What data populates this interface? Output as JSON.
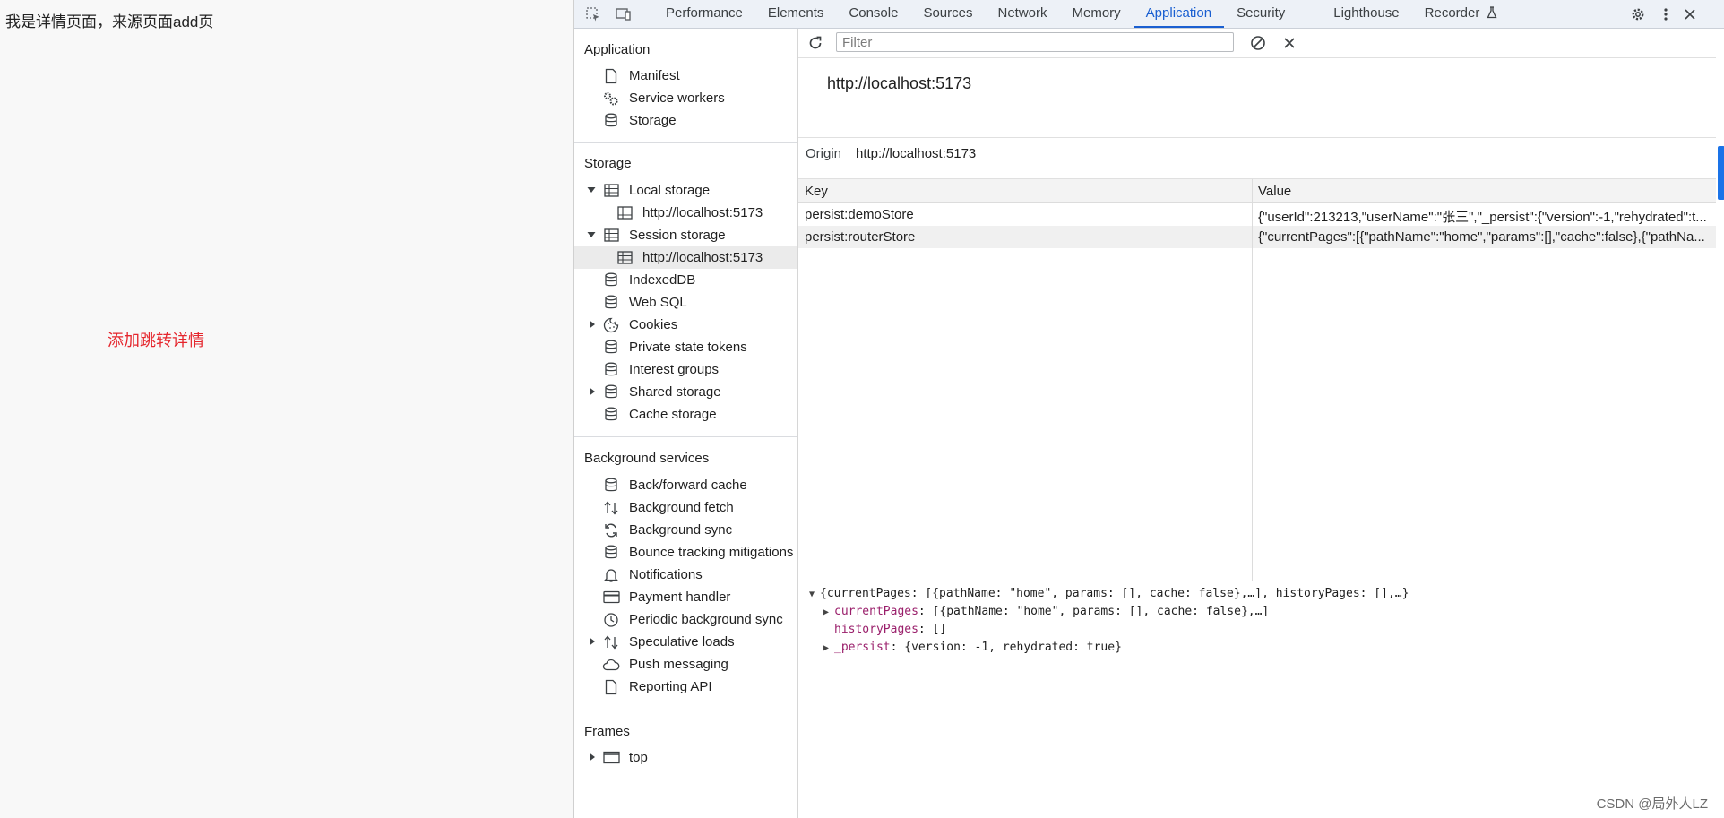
{
  "page": {
    "heading": "我是详情页面，来源页面add页",
    "link": "添加跳转详情"
  },
  "toolbar": {
    "tabs": [
      {
        "label": "Performance"
      },
      {
        "label": "Elements"
      },
      {
        "label": "Console"
      },
      {
        "label": "Sources"
      },
      {
        "label": "Network"
      },
      {
        "label": "Memory"
      },
      {
        "label": "Application"
      },
      {
        "label": "Security"
      },
      {
        "label": "Lighthouse"
      },
      {
        "label": "Recorder"
      }
    ],
    "active_tab": "Application"
  },
  "sidebar": {
    "application": {
      "title": "Application",
      "items": [
        {
          "label": "Manifest",
          "icon": "file-icon"
        },
        {
          "label": "Service workers",
          "icon": "gears-icon"
        },
        {
          "label": "Storage",
          "icon": "database-icon"
        }
      ]
    },
    "storage": {
      "title": "Storage",
      "items": [
        {
          "label": "Local storage",
          "icon": "table-icon",
          "expanded": true
        },
        {
          "label": "http://localhost:5173",
          "icon": "table-icon"
        },
        {
          "label": "Session storage",
          "icon": "table-icon",
          "expanded": true
        },
        {
          "label": "http://localhost:5173",
          "icon": "table-icon",
          "selected": true
        },
        {
          "label": "IndexedDB",
          "icon": "database-icon"
        },
        {
          "label": "Web SQL",
          "icon": "database-icon"
        },
        {
          "label": "Cookies",
          "icon": "cookie-icon",
          "expanded": false
        },
        {
          "label": "Private state tokens",
          "icon": "database-icon"
        },
        {
          "label": "Interest groups",
          "icon": "database-icon"
        },
        {
          "label": "Shared storage",
          "icon": "database-icon",
          "expanded": false
        },
        {
          "label": "Cache storage",
          "icon": "database-icon"
        }
      ]
    },
    "background": {
      "title": "Background services",
      "items": [
        {
          "label": "Back/forward cache",
          "icon": "database-icon"
        },
        {
          "label": "Background fetch",
          "icon": "arrows-updown-icon"
        },
        {
          "label": "Background sync",
          "icon": "sync-icon"
        },
        {
          "label": "Bounce tracking mitigations",
          "icon": "database-icon"
        },
        {
          "label": "Notifications",
          "icon": "bell-icon"
        },
        {
          "label": "Payment handler",
          "icon": "card-icon"
        },
        {
          "label": "Periodic background sync",
          "icon": "clock-icon"
        },
        {
          "label": "Speculative loads",
          "icon": "arrows-updown-icon",
          "expanded": false
        },
        {
          "label": "Push messaging",
          "icon": "cloud-icon"
        },
        {
          "label": "Reporting API",
          "icon": "file-icon"
        }
      ]
    },
    "frames": {
      "title": "Frames",
      "items": [
        {
          "label": "top",
          "icon": "window-icon",
          "expanded": false
        }
      ]
    }
  },
  "main": {
    "filter_placeholder": "Filter",
    "origin_title": "http://localhost:5173",
    "origin_label": "Origin",
    "origin_value": "http://localhost:5173",
    "columns": {
      "key": "Key",
      "value": "Value"
    },
    "rows": [
      {
        "key": "persist:demoStore",
        "value": "{\"userId\":213213,\"userName\":\"张三\",\"_persist\":{\"version\":-1,\"rehydrated\":t..."
      },
      {
        "key": "persist:routerStore",
        "value": "{\"currentPages\":[{\"pathName\":\"home\",\"params\":[],\"cache\":false},{\"pathNa..."
      }
    ],
    "preview": {
      "summary": "{currentPages: [{pathName: \"home\", params: [], cache: false},…], historyPages: [],…}",
      "lines": [
        {
          "key": "currentPages",
          "value": "[{pathName: \"home\", params: [], cache: false},…]",
          "expandable": true
        },
        {
          "key": "historyPages",
          "value": "[]",
          "expandable": false
        },
        {
          "key": "_persist",
          "value": "{version: -1, rehydrated: true}",
          "expandable": true
        }
      ]
    }
  },
  "watermark": "CSDN @局外人LZ",
  "colors": {
    "accent": "#1a5fd1",
    "link_red": "#e5262d",
    "preview_key": "#9a1f6b"
  }
}
